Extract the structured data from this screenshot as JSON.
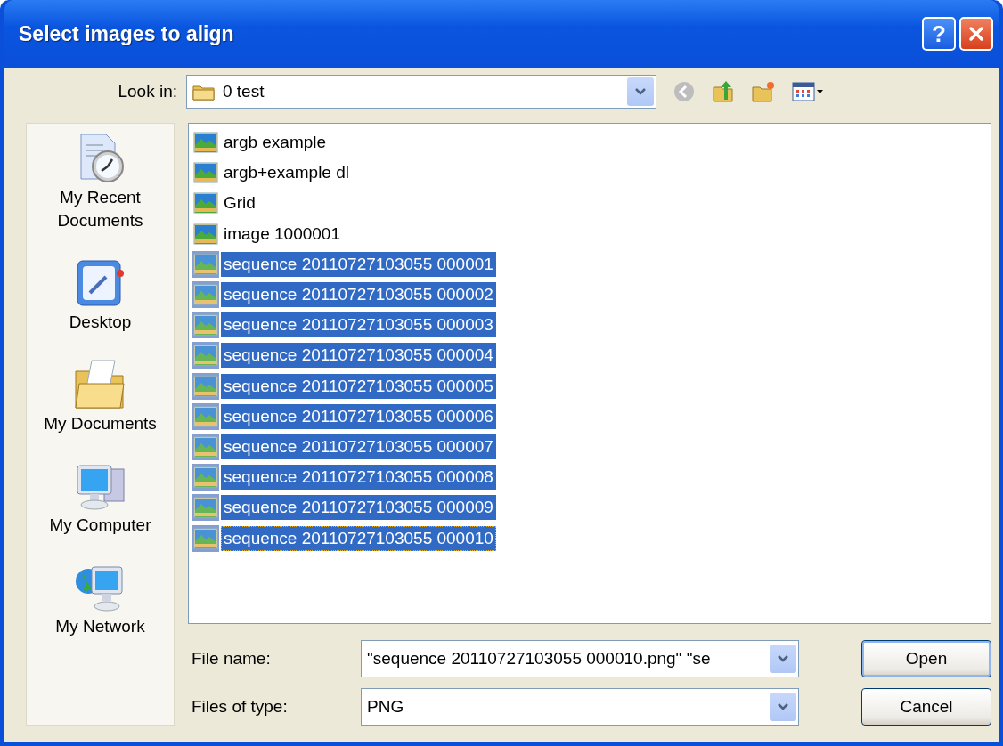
{
  "window": {
    "title": "Select images to align",
    "help_button": "?"
  },
  "look_in": {
    "label": "Look in:",
    "value": "0 test"
  },
  "places": [
    {
      "kind": "recent",
      "label": "My Recent Documents"
    },
    {
      "kind": "desktop",
      "label": "Desktop"
    },
    {
      "kind": "documents",
      "label": "My Documents"
    },
    {
      "kind": "computer",
      "label": "My Computer"
    },
    {
      "kind": "network",
      "label": "My Network"
    }
  ],
  "files": [
    {
      "name": "argb example",
      "selected": false,
      "focused": false
    },
    {
      "name": "argb+example dl",
      "selected": false,
      "focused": false
    },
    {
      "name": "Grid",
      "selected": false,
      "focused": false
    },
    {
      "name": "image 1000001",
      "selected": false,
      "focused": false
    },
    {
      "name": "sequence 20110727103055 000001",
      "selected": true,
      "focused": false
    },
    {
      "name": "sequence 20110727103055 000002",
      "selected": true,
      "focused": false
    },
    {
      "name": "sequence 20110727103055 000003",
      "selected": true,
      "focused": false
    },
    {
      "name": "sequence 20110727103055 000004",
      "selected": true,
      "focused": false
    },
    {
      "name": "sequence 20110727103055 000005",
      "selected": true,
      "focused": false
    },
    {
      "name": "sequence 20110727103055 000006",
      "selected": true,
      "focused": false
    },
    {
      "name": "sequence 20110727103055 000007",
      "selected": true,
      "focused": false
    },
    {
      "name": "sequence 20110727103055 000008",
      "selected": true,
      "focused": false
    },
    {
      "name": "sequence 20110727103055 000009",
      "selected": true,
      "focused": false
    },
    {
      "name": "sequence 20110727103055 000010",
      "selected": true,
      "focused": true
    }
  ],
  "file_name": {
    "label": "File name:",
    "value": "\"sequence 20110727103055 000010.png\" \"se"
  },
  "file_type": {
    "label": "Files of type:",
    "value": "PNG"
  },
  "buttons": [
    {
      "label": "Open",
      "default": true
    },
    {
      "label": "Cancel",
      "default": false
    }
  ]
}
